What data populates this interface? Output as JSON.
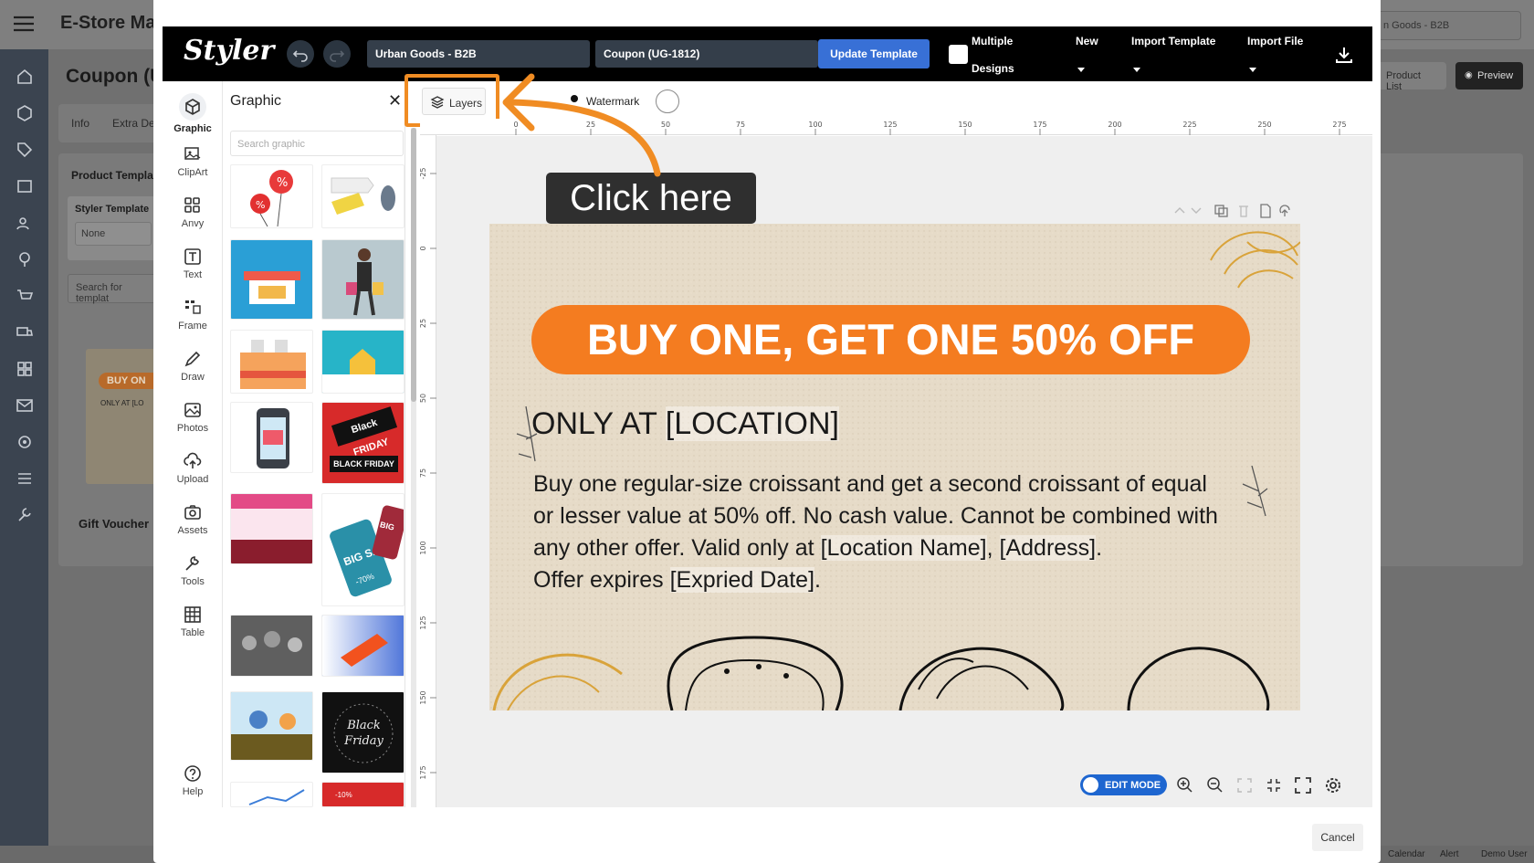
{
  "background": {
    "app_brand": "E-Store Man",
    "page_title": "Coupon (U",
    "tabs": [
      "Info",
      "Extra De"
    ],
    "card_title": "Product Templa",
    "styler_template_label": "Styler Template",
    "styler_template_value": "None",
    "search_placeholder": "Search for templat",
    "thumb_title": "Gift Voucher",
    "thumb_banner": "BUY ON",
    "thumb_line": "ONLY AT [LO",
    "store_select": "n Goods - B2B",
    "product_list_btn": "Product List",
    "preview_btn": "Preview",
    "footer": [
      "Calendar",
      "Alert",
      "Demo User"
    ]
  },
  "toolbar": {
    "logo": "Styler",
    "store_field": "Urban Goods - B2B",
    "template_field": "Coupon (UG-1812)",
    "update_button": "Update Template",
    "multiple_designs_line1": "Multiple",
    "multiple_designs_line2": "Designs",
    "new_label": "New",
    "import_template_label": "Import Template",
    "import_file_label": "Import File"
  },
  "rail": [
    {
      "label": "Graphic",
      "icon": "cube-icon"
    },
    {
      "label": "ClipArt",
      "icon": "clipart-icon"
    },
    {
      "label": "Anvy",
      "icon": "grid-icon"
    },
    {
      "label": "Text",
      "icon": "text-icon"
    },
    {
      "label": "Frame",
      "icon": "frame-icon"
    },
    {
      "label": "Draw",
      "icon": "pen-icon"
    },
    {
      "label": "Photos",
      "icon": "image-icon"
    },
    {
      "label": "Upload",
      "icon": "upload-icon"
    },
    {
      "label": "Assets",
      "icon": "camera-icon"
    },
    {
      "label": "Tools",
      "icon": "wrench-icon"
    },
    {
      "label": "Table",
      "icon": "table-icon"
    },
    {
      "label": "Help",
      "icon": "help-icon"
    }
  ],
  "panel": {
    "title": "Graphic",
    "search_placeholder": "Search graphic",
    "thumb_texts": {
      "black_friday": "Black FRIDAY",
      "black_friday_sub": "BLACK FRIDAY",
      "big_sale": "BIG SALE",
      "big_sale_pct": "-70%",
      "big": "BIG",
      "black_friday_script": "Black Friday",
      "minus10": "-10%"
    }
  },
  "canvas_toolbar": {
    "layers_label": "Layers",
    "watermark_label": "Watermark"
  },
  "ruler_h": [
    "0",
    "25",
    "50",
    "75",
    "100",
    "125",
    "150",
    "175",
    "200",
    "225",
    "250",
    "275"
  ],
  "ruler_v": [
    "-25",
    "0",
    "25",
    "50",
    "75",
    "100",
    "125",
    "150",
    "175"
  ],
  "tooltip": "Click here",
  "coupon": {
    "banner": "BUY ONE, GET ONE 50% OFF",
    "location_prefix": "ONLY AT ",
    "location_token": "[LOCATION]",
    "line1": "Buy one regular-size croissant and get a second croissant of equal",
    "line2": "or lesser value at 50% off. No cash value. Cannot be combined with",
    "line3_prefix": "any other offer. Valid only at ",
    "line3_token1": "[Location Name]",
    "line3_sep": ", ",
    "line3_token2": "[Address]",
    "line3_suffix": ".",
    "line4_prefix": "Offer expires ",
    "line4_token": "[Expried Date]",
    "line4_suffix": ".",
    "banner_color": "#f47c20"
  },
  "bottom": {
    "edit_mode_label": "EDIT MODE",
    "cancel_label": "Cancel"
  },
  "colors": {
    "accent_orange": "#f08c23",
    "primary_blue": "#3870d6"
  }
}
